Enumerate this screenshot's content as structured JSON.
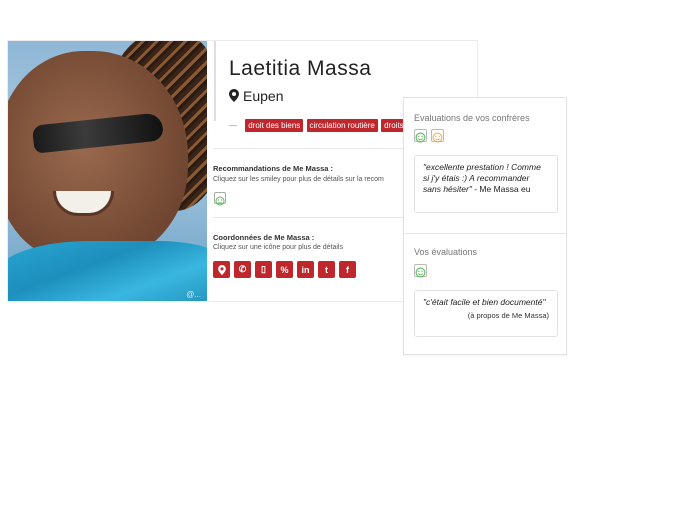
{
  "profile": {
    "name": "Laetitia Massa",
    "city": "Eupen",
    "tags_dash": "—",
    "tags": [
      "droit des biens",
      "circulation routière",
      "droits d"
    ],
    "photo_watermark": "@..."
  },
  "recommendations": {
    "title": "Recommandations de Me Massa :",
    "subtitle": "Cliquez sur les smiley pour plus de détails sur la recom"
  },
  "contact": {
    "title": "Coordonnées de Me Massa :",
    "subtitle": "Cliquez sur une icône pour plus de détails",
    "icons": [
      "map-marker-icon",
      "phone-icon",
      "mobile-icon",
      "link-icon",
      "linkedin-icon",
      "twitter-icon",
      "facebook-icon"
    ],
    "icon_glyphs": [
      "⬤",
      "✆",
      "▯",
      "%",
      "in",
      "t",
      "f"
    ]
  },
  "peer_evaluations": {
    "title": "Evaluations de vos confrères",
    "quote": "\"excellente prestation ! Comme si j'y étais :) A recommander sans hésiter\"",
    "author": " - Me Massa eu"
  },
  "your_evaluations": {
    "title": "Vos évaluations",
    "quote": "\"c'était facile et bien documenté\"",
    "about": "(à propos de Me Massa)"
  },
  "colors": {
    "accent": "#c0272d",
    "smiley_green": "#5cb85c",
    "smiley_orange": "#f0ad4e"
  }
}
